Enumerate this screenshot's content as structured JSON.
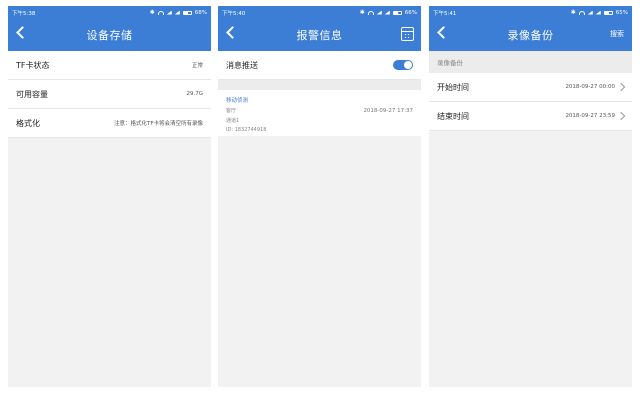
{
  "screens": [
    {
      "status_time": "下午5:38",
      "battery": "68%",
      "title": "设备存储",
      "rows": [
        {
          "label": "TF卡状态",
          "value": "正常"
        },
        {
          "label": "可用容量",
          "value": "29.7G"
        },
        {
          "label": "格式化",
          "value": "注意：格式化TF卡将会清空所有录像"
        }
      ]
    },
    {
      "status_time": "下午5:40",
      "battery": "66%",
      "title": "报警信息",
      "push_label": "消息推送",
      "push_enabled": true,
      "alarm": {
        "type": "移动侦测",
        "line1": "客厅",
        "line2": "通道1",
        "line3": "ID: 1832744918",
        "time": "2018-09-27 17:37"
      }
    },
    {
      "status_time": "下午5:41",
      "battery": "65%",
      "title": "录像备份",
      "action": "搜索",
      "section": "录像备份",
      "rows": [
        {
          "label": "开始时间",
          "value": "2018-09-27 00:00"
        },
        {
          "label": "结束时间",
          "value": "2018-09-27 23:59"
        }
      ]
    }
  ],
  "colors": {
    "accent": "#3c7ed6",
    "background": "#f2f2f2"
  },
  "icons": [
    "back-arrow-icon",
    "calendar-icon",
    "chevron-right-icon",
    "toggle-switch"
  ]
}
